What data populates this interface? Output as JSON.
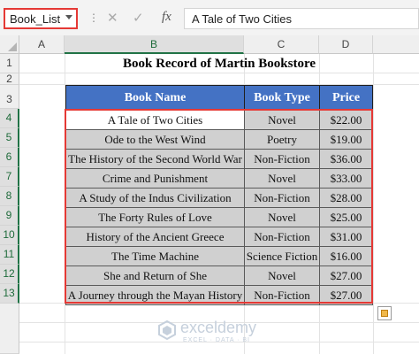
{
  "formula_bar": {
    "name_box": "Book_List",
    "cancel_icon": "✕",
    "enter_icon": "✓",
    "fx_label": "fx",
    "formula_value": "A Tale of Two Cities"
  },
  "columns": [
    "A",
    "B",
    "C",
    "D"
  ],
  "rows": [
    "1",
    "2",
    "3",
    "4",
    "5",
    "6",
    "7",
    "8",
    "9",
    "10",
    "11",
    "12",
    "13"
  ],
  "sheet": {
    "title": "Book Record of Martin Bookstore",
    "headers": [
      "Book Name",
      "Book Type",
      "Price"
    ],
    "books": [
      {
        "name": "A Tale of Two Cities",
        "type": "Novel",
        "price": "$22.00"
      },
      {
        "name": "Ode to the West Wind",
        "type": "Poetry",
        "price": "$19.00"
      },
      {
        "name": "The History of the Second World War",
        "type": "Non-Fiction",
        "price": "$36.00"
      },
      {
        "name": "Crime and Punishment",
        "type": "Novel",
        "price": "$33.00"
      },
      {
        "name": "A Study of the Indus Civilization",
        "type": "Non-Fiction",
        "price": "$28.00"
      },
      {
        "name": "The Forty Rules of Love",
        "type": "Novel",
        "price": "$25.00"
      },
      {
        "name": "History of the Ancient Greece",
        "type": "Non-Fiction",
        "price": "$31.00"
      },
      {
        "name": "The Time Machine",
        "type": "Science Fiction",
        "price": "$16.00"
      },
      {
        "name": "She and Return of She",
        "type": "Novel",
        "price": "$27.00"
      },
      {
        "name": "A Journey through the Mayan History",
        "type": "Non-Fiction",
        "price": "$27.00"
      }
    ]
  },
  "watermark": {
    "name": "exceldemy",
    "tagline": "EXCEL · DATA · BI"
  },
  "colors": {
    "header_fill": "#4472c4",
    "cell_fill": "#d0d0d0",
    "selection_outline": "#e53935",
    "excel_green": "#217346"
  }
}
